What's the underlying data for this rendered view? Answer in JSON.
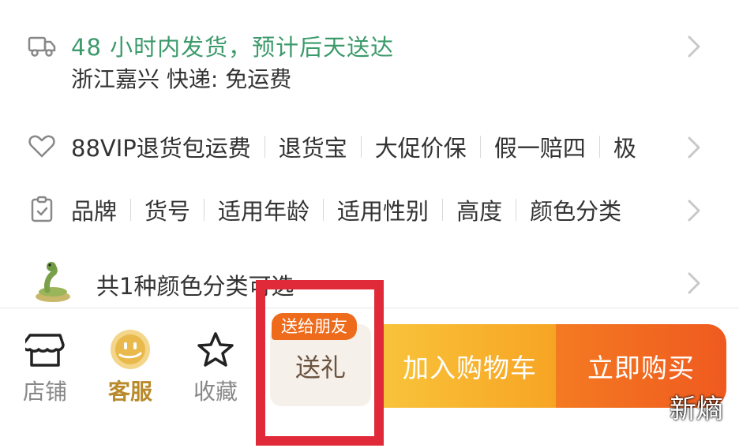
{
  "shipping": {
    "main": "48 小时内发货，预计后天送达",
    "sub": "浙江嘉兴  快递: 免运费",
    "icon": "truck-icon"
  },
  "guarantees": {
    "icon": "heart-shield-icon",
    "items": [
      "88VIP退货包运费",
      "退货宝",
      "大促价保",
      "假一赔四",
      "极"
    ]
  },
  "params": {
    "icon": "clipboard-icon",
    "items": [
      "品牌",
      "货号",
      "适用年龄",
      "适用性别",
      "高度",
      "颜色分类"
    ]
  },
  "color_variants": {
    "text": "共1种颜色分类可选",
    "thumb_icon": "snake-toy-thumbnail"
  },
  "bottom_bar": {
    "store": "店铺",
    "service": "客服",
    "favorite": "收藏",
    "gift_badge": "送给朋友",
    "gift": "送礼",
    "add_to_cart": "加入购物车",
    "buy_now": "立即购买"
  },
  "colors": {
    "shipping_green": "#3c9a6b",
    "cart_yellow": "#f8b52e",
    "buy_orange": "#f0621f",
    "highlight_red": "#e02a3a",
    "service_gold": "#b98a2b"
  },
  "watermark": "新熵"
}
